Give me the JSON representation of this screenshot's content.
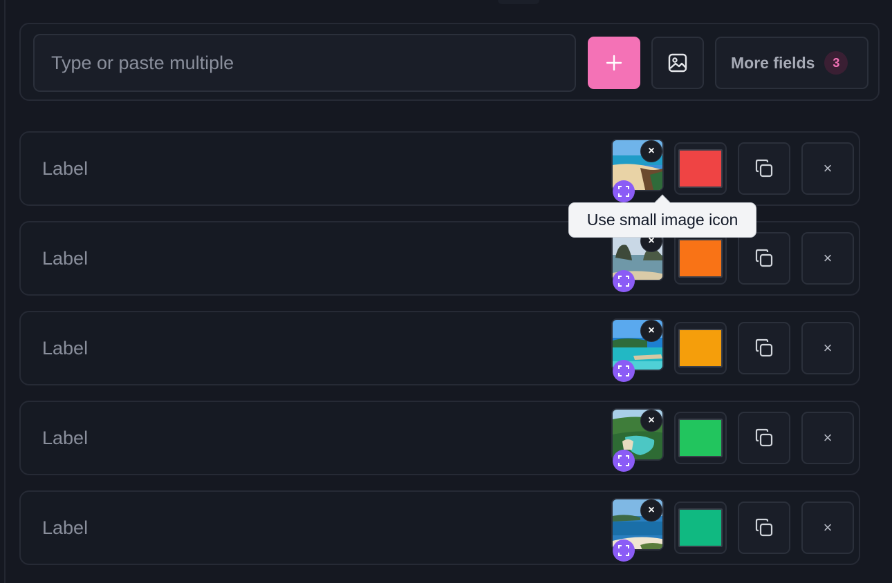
{
  "input_bar": {
    "placeholder": "Type or paste multiple",
    "add_icon": "plus-icon",
    "image_icon": "image-icon",
    "more_fields_label": "More fields",
    "more_fields_count": "3"
  },
  "rows": [
    {
      "label": "Label",
      "color": "#ef4444",
      "thumb": "beach-sand"
    },
    {
      "label": "Label",
      "color": "#f97316",
      "thumb": "rock-islands"
    },
    {
      "label": "Label",
      "color": "#f59e0b",
      "thumb": "turquoise-sea"
    },
    {
      "label": "Label",
      "color": "#22c55e",
      "thumb": "green-cove"
    },
    {
      "label": "Label",
      "color": "#10b981",
      "thumb": "white-beach"
    }
  ],
  "row_icons": {
    "remove_image": "close-icon",
    "expand": "expand-icon",
    "duplicate": "copy-icon",
    "delete": "close-icon"
  },
  "tooltip": {
    "text": "Use small image icon"
  },
  "colors": {
    "accent_pink": "#f472b6",
    "accent_purple": "#8b5cf6",
    "background": "#151821"
  }
}
